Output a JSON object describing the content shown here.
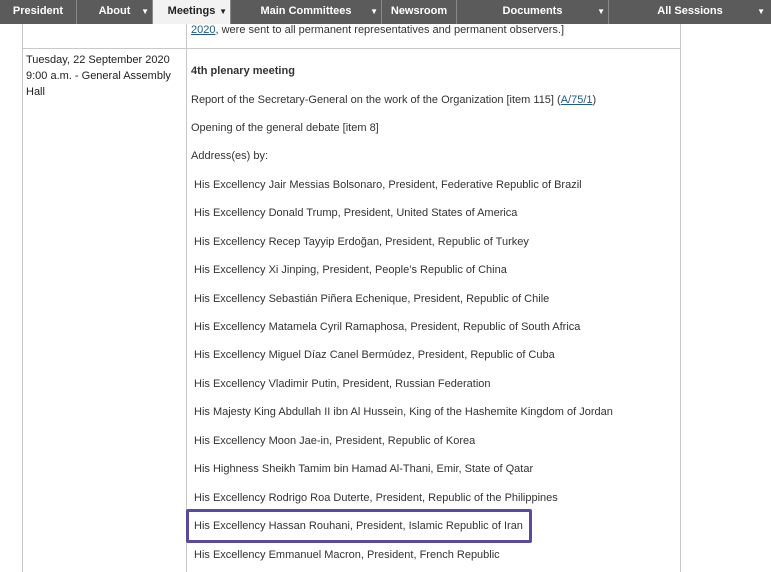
{
  "nav": {
    "items": [
      {
        "label": "President"
      },
      {
        "label": "About"
      },
      {
        "label": "Meetings"
      },
      {
        "label": "Main Committees"
      },
      {
        "label": "Newsroom"
      },
      {
        "label": "Documents"
      },
      {
        "label": "All Sessions"
      }
    ]
  },
  "prev_row": {
    "link": "2020",
    "text": ", were sent to all permanent representatives and permanent observers.]"
  },
  "meeting": {
    "date": "Tuesday, 22 September 2020",
    "time_place": "9:00 a.m. - General Assembly Hall",
    "title": "4th plenary meeting",
    "report_text": "Report of the Secretary-General on the work of the Organization [item 115] (",
    "report_link": "A/75/1",
    "report_close": ")",
    "debate": "Opening of the general debate [item 8]",
    "addresses_label": "Address(es) by:",
    "speakers": [
      "His Excellency Jair Messias Bolsonaro, President, Federative Republic of Brazil",
      "His Excellency Donald Trump, President, United States of America",
      "His Excellency Recep Tayyip Erdoğan, President, Republic of Turkey",
      "His Excellency Xi Jinping, President, People’s Republic of China",
      "His Excellency Sebastián Piñera Echenique, President, Republic of Chile",
      "His Excellency Matamela Cyril Ramaphosa, President, Republic of South Africa",
      "His Excellency Miguel Díaz Canel Bermúdez, President, Republic of Cuba",
      "His Excellency Vladimir Putin, President, Russian Federation",
      "His Majesty King Abdullah II ibn Al Hussein, King of the Hashemite Kingdom of Jordan",
      "His Excellency Moon Jae-in, President, Republic of Korea",
      "His Highness Sheikh Tamim bin Hamad Al-Thani, Emir, State of Qatar",
      "His Excellency Rodrigo Roa Duterte, President, Republic of the Philippines",
      "His Excellency Hassan Rouhani, President, Islamic Republic of Iran",
      "His Excellency Emmanuel Macron, President, French Republic"
    ]
  },
  "colors": {
    "nav_bg": "#5b5b5b",
    "nav_active_bg": "#f2f2f2",
    "link": "#1e5a8c",
    "highlight_border": "#5a4a9e"
  }
}
